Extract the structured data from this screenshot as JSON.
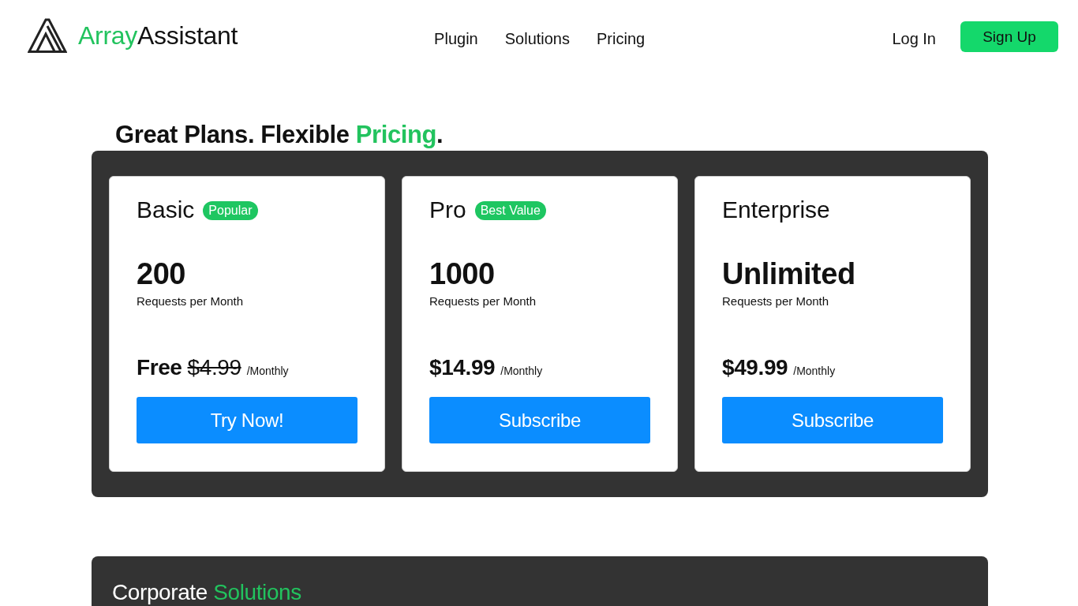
{
  "header": {
    "brand": [
      {
        "text": "Array",
        "accent": true
      },
      {
        "text": "Assistant",
        "accent": false
      }
    ],
    "nav": [
      "Plugin",
      "Solutions",
      "Pricing"
    ],
    "login": "Log In",
    "signup": "Sign Up"
  },
  "pricing": {
    "heading": [
      {
        "text": "Great Plans. Flexible ",
        "accent": false
      },
      {
        "text": "Pricing",
        "accent": true
      },
      {
        "text": ".",
        "accent": false
      }
    ],
    "plans": [
      {
        "name": "Basic",
        "badge": "Popular",
        "quota": "200",
        "quota_label": "Requests per Month",
        "price": "Free",
        "original_price": "$4.99",
        "period": "/Monthly",
        "action": "Try Now!"
      },
      {
        "name": "Pro",
        "badge": "Best Value",
        "quota": "1000",
        "quota_label": "Requests per Month",
        "price": "$14.99",
        "period": "/Monthly",
        "action": "Subscribe"
      },
      {
        "name": "Enterprise",
        "quota": "Unlimited",
        "quota_label": "Requests per Month",
        "price": "$49.99",
        "period": "/Monthly",
        "action": "Subscribe"
      }
    ]
  },
  "corporate": {
    "heading": [
      {
        "text": "Corporate ",
        "accent": false
      },
      {
        "text": "Solutions",
        "accent": true
      }
    ]
  }
}
